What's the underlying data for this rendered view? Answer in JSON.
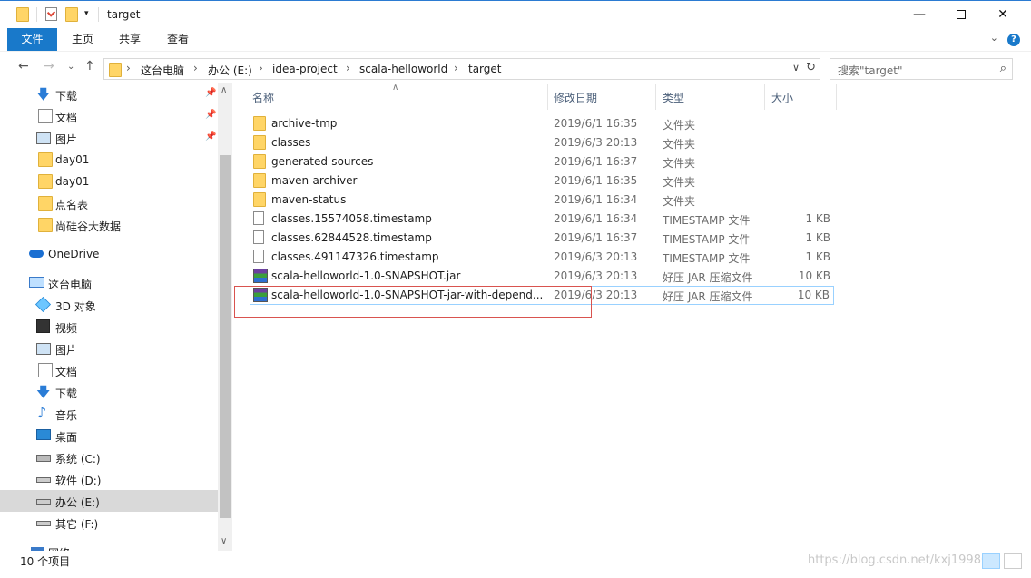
{
  "window": {
    "title": "target"
  },
  "ribbon": {
    "file": "文件",
    "home": "主页",
    "share": "共享",
    "view": "查看",
    "help": "?"
  },
  "address": {
    "crumbs": [
      "这台电脑",
      "办公 (E:)",
      "idea-project",
      "scala-helloworld",
      "target"
    ],
    "sep": "›"
  },
  "search": {
    "placeholder": "搜索\"target\""
  },
  "nav": {
    "quick": [
      {
        "label": "下载",
        "icon": "download-icon",
        "pinned": true
      },
      {
        "label": "文档",
        "icon": "document-icon",
        "pinned": true
      },
      {
        "label": "图片",
        "icon": "picture-icon",
        "pinned": true
      },
      {
        "label": "day01",
        "icon": "folder-icon",
        "pinned": false
      },
      {
        "label": "day01",
        "icon": "folder-icon",
        "pinned": false
      },
      {
        "label": "点名表",
        "icon": "folder-icon",
        "pinned": false
      },
      {
        "label": "尚硅谷大数据",
        "icon": "folder-icon",
        "pinned": false
      }
    ],
    "onedrive": "OneDrive",
    "thispc": "这台电脑",
    "pc_items": [
      {
        "label": "3D 对象",
        "icon": "3d-objects-icon"
      },
      {
        "label": "视频",
        "icon": "video-icon"
      },
      {
        "label": "图片",
        "icon": "picture-icon"
      },
      {
        "label": "文档",
        "icon": "document-icon"
      },
      {
        "label": "下载",
        "icon": "download-icon"
      },
      {
        "label": "音乐",
        "icon": "music-icon"
      },
      {
        "label": "桌面",
        "icon": "desktop-icon"
      },
      {
        "label": "系统 (C:)",
        "icon": "system-drive-icon"
      },
      {
        "label": "软件 (D:)",
        "icon": "drive-icon"
      },
      {
        "label": "办公 (E:)",
        "icon": "drive-icon",
        "selected": true
      },
      {
        "label": "其它 (F:)",
        "icon": "drive-icon"
      }
    ],
    "network": "网络"
  },
  "columns": {
    "name": "名称",
    "date": "修改日期",
    "type": "类型",
    "size": "大小"
  },
  "files": [
    {
      "name": "archive-tmp",
      "date": "2019/6/1 16:35",
      "type": "文件夹",
      "size": "",
      "icon": "folder-icon"
    },
    {
      "name": "classes",
      "date": "2019/6/3 20:13",
      "type": "文件夹",
      "size": "",
      "icon": "folder-icon"
    },
    {
      "name": "generated-sources",
      "date": "2019/6/1 16:37",
      "type": "文件夹",
      "size": "",
      "icon": "folder-icon"
    },
    {
      "name": "maven-archiver",
      "date": "2019/6/1 16:35",
      "type": "文件夹",
      "size": "",
      "icon": "folder-icon"
    },
    {
      "name": "maven-status",
      "date": "2019/6/1 16:34",
      "type": "文件夹",
      "size": "",
      "icon": "folder-icon"
    },
    {
      "name": "classes.15574058.timestamp",
      "date": "2019/6/1 16:34",
      "type": "TIMESTAMP 文件",
      "size": "1 KB",
      "icon": "file-icon"
    },
    {
      "name": "classes.62844528.timestamp",
      "date": "2019/6/1 16:37",
      "type": "TIMESTAMP 文件",
      "size": "1 KB",
      "icon": "file-icon"
    },
    {
      "name": "classes.491147326.timestamp",
      "date": "2019/6/3 20:13",
      "type": "TIMESTAMP 文件",
      "size": "1 KB",
      "icon": "file-icon"
    },
    {
      "name": "scala-helloworld-1.0-SNAPSHOT.jar",
      "date": "2019/6/3 20:13",
      "type": "好压 JAR 压缩文件",
      "size": "10 KB",
      "icon": "jar-icon"
    },
    {
      "name": "scala-helloworld-1.0-SNAPSHOT-jar-with-depend...",
      "date": "2019/6/3 20:13",
      "type": "好压 JAR 压缩文件",
      "size": "10 KB",
      "icon": "jar-icon",
      "highlighted": true
    }
  ],
  "status": {
    "count": "10 个项目"
  },
  "watermark": "https://blog.csdn.net/kxj19980"
}
